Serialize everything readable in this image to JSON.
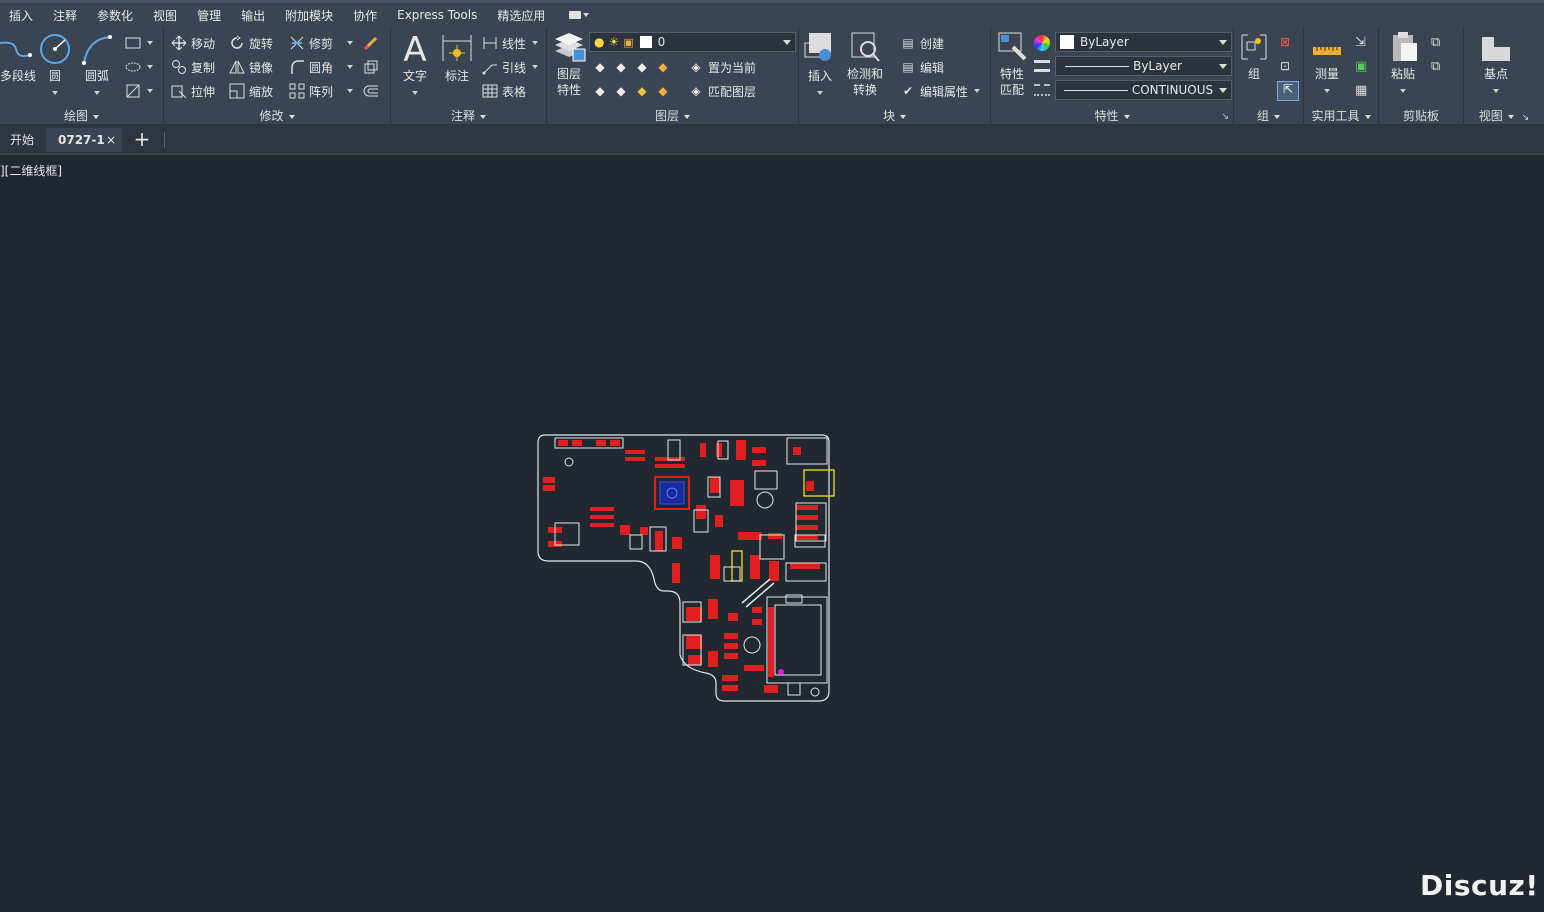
{
  "menu": [
    "插入",
    "注释",
    "参数化",
    "视图",
    "管理",
    "输出",
    "附加模块",
    "协作",
    "Express Tools",
    "精选应用"
  ],
  "draw_panel": {
    "title": "绘图",
    "polyline": "多段线",
    "circle": "圆",
    "arc": "圆弧"
  },
  "modify_panel": {
    "title": "修改",
    "move": "移动",
    "rotate": "旋转",
    "trim": "修剪",
    "copy": "复制",
    "mirror": "镜像",
    "fillet": "圆角",
    "stretch": "拉伸",
    "scale": "缩放",
    "array": "阵列"
  },
  "annotation_panel": {
    "title": "注释",
    "text": "文字",
    "dimension": "标注",
    "linear": "线性",
    "leader": "引线",
    "table": "表格"
  },
  "layers_panel": {
    "title": "图层",
    "layer_props": "图层特性",
    "layer_props_l1": "图层",
    "layer_props_l2": "特性",
    "current_layer": "0",
    "set_current": "置为当前",
    "match_layer": "匹配图层"
  },
  "block_panel": {
    "title": "块",
    "insert": "插入",
    "detect_l1": "检测和",
    "detect_l2": "转换",
    "create": "创建",
    "edit": "编辑",
    "edit_attr": "编辑属性"
  },
  "properties_panel": {
    "title": "特性",
    "match_l1": "特性",
    "match_l2": "匹配",
    "color": "ByLayer",
    "lineweight": "ByLayer",
    "linetype": "CONTINUOUS"
  },
  "group_panel": {
    "title": "组",
    "group": "组"
  },
  "utilities_panel": {
    "title": "实用工具",
    "measure": "测量"
  },
  "clipboard_panel": {
    "title": "剪贴板",
    "paste": "粘贴"
  },
  "view_panel": {
    "title": "视图",
    "base": "基点"
  },
  "tabs": {
    "start": "开始",
    "file": "0727-1",
    "close": "×",
    "new": "+"
  },
  "viewport": {
    "label": "][二维线框]"
  },
  "watermark": "Discuz!"
}
